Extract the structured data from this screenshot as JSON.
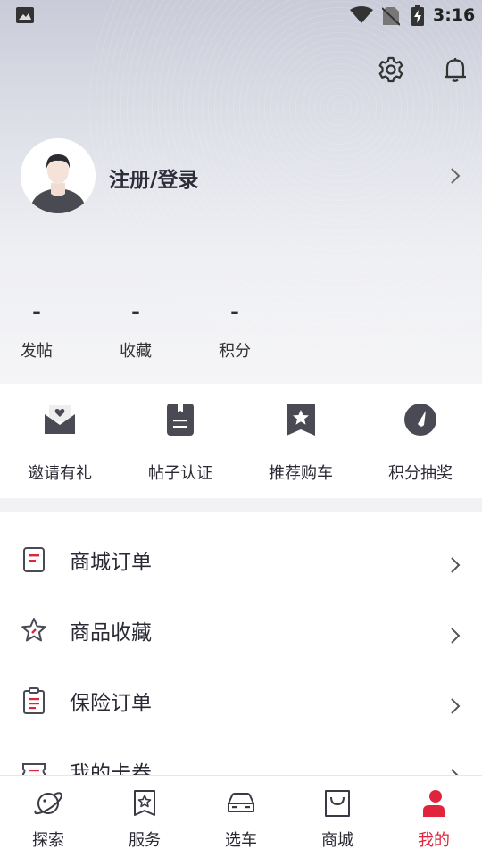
{
  "status_bar": {
    "time": "3:16"
  },
  "profile": {
    "login_label": "注册/登录"
  },
  "stats": [
    {
      "value": "-",
      "label": "发帖"
    },
    {
      "value": "-",
      "label": "收藏"
    },
    {
      "value": "-",
      "label": "积分"
    }
  ],
  "quick_actions": [
    {
      "label": "邀请有礼",
      "icon": "invite-envelope-icon"
    },
    {
      "label": "帖子认证",
      "icon": "post-document-icon"
    },
    {
      "label": "推荐购车",
      "icon": "bookmark-star-icon"
    },
    {
      "label": "积分抽奖",
      "icon": "lottery-dial-icon"
    }
  ],
  "menu": [
    {
      "label": "商城订单",
      "icon": "order-doc-icon"
    },
    {
      "label": "商品收藏",
      "icon": "star-icon"
    },
    {
      "label": "保险订单",
      "icon": "clipboard-icon"
    },
    {
      "label": "我的卡券",
      "icon": "coupon-icon"
    }
  ],
  "bottom_nav": [
    {
      "label": "探索",
      "icon": "explore-planet-icon"
    },
    {
      "label": "服务",
      "icon": "service-badge-icon"
    },
    {
      "label": "选车",
      "icon": "car-icon"
    },
    {
      "label": "商城",
      "icon": "shopping-bag-icon"
    },
    {
      "label": "我的",
      "icon": "profile-person-icon",
      "active": true
    }
  ],
  "colors": {
    "accent": "#e0243b",
    "icon_gray": "#4a4a55"
  }
}
